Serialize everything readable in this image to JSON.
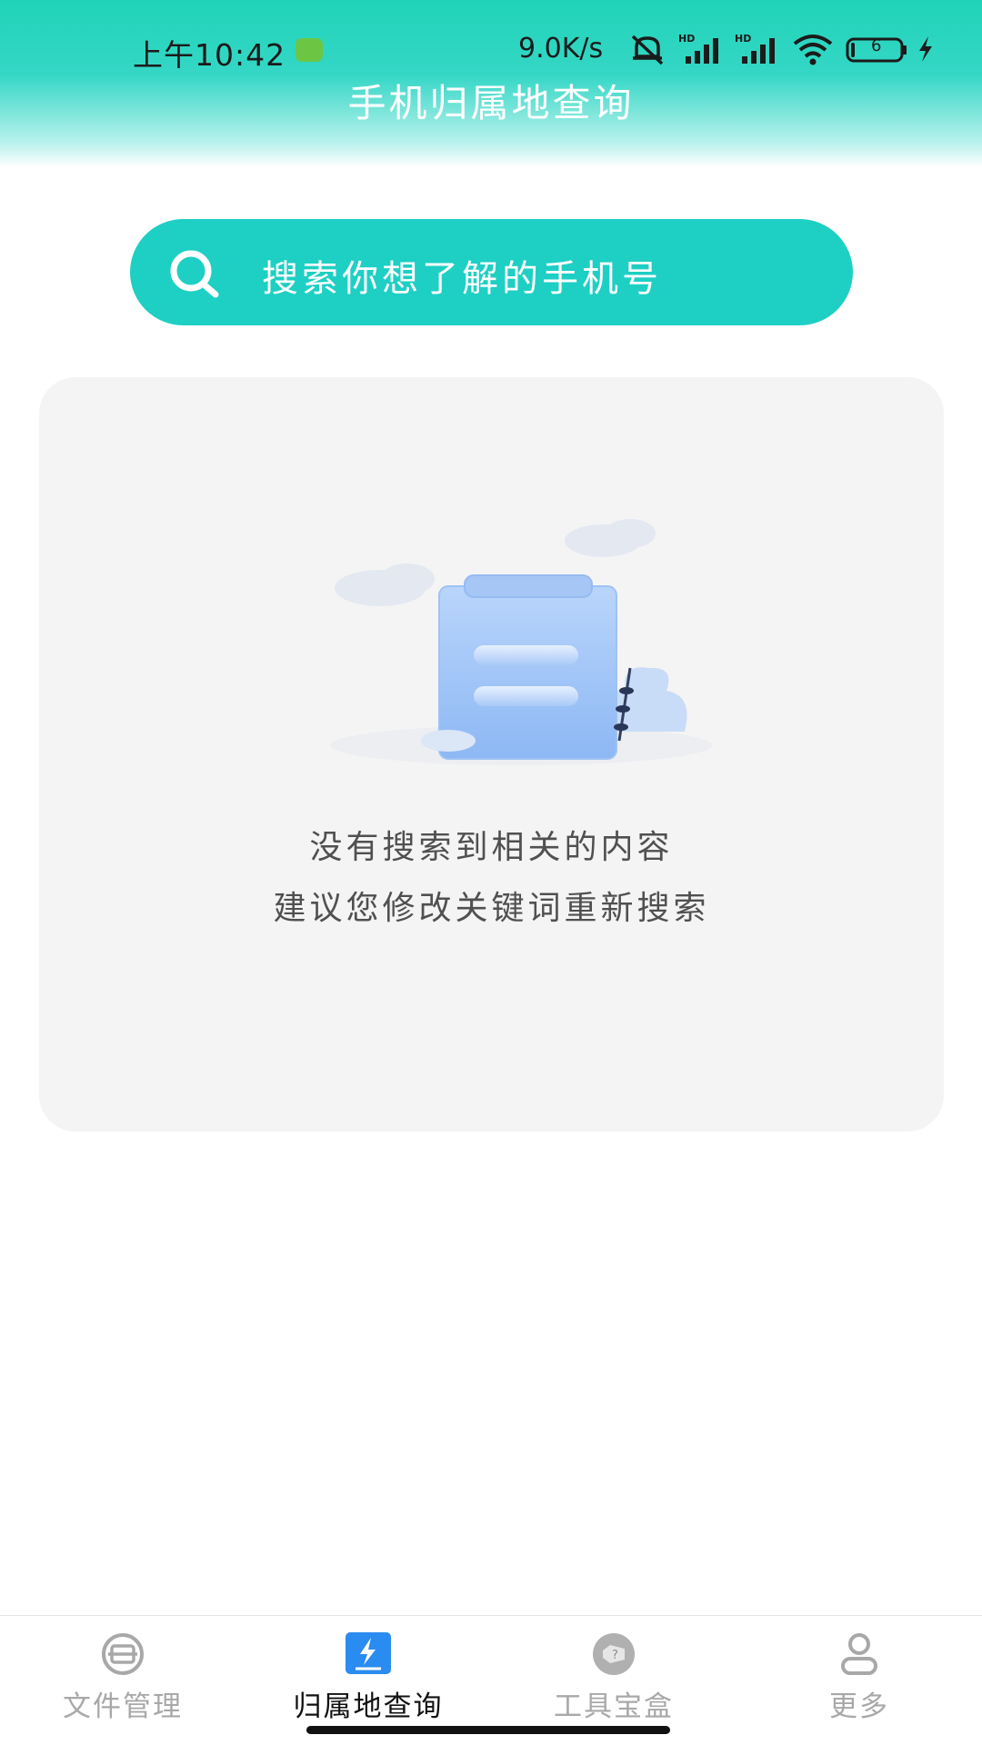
{
  "status_bar": {
    "time": "上午10:42",
    "net_speed": "9.0K/s",
    "battery_level": "6"
  },
  "header": {
    "title": "手机归属地查询"
  },
  "search": {
    "placeholder": "搜索你想了解的手机号"
  },
  "empty_state": {
    "line1": "没有搜索到相关的内容",
    "line2": "建议您修改关键词重新搜索"
  },
  "bottom_nav": {
    "items": [
      {
        "label": "文件管理",
        "icon": "file-scan-icon",
        "active": false
      },
      {
        "label": "归属地查询",
        "icon": "lightning-icon",
        "active": true
      },
      {
        "label": "工具宝盒",
        "icon": "toolbox-icon",
        "active": false
      },
      {
        "label": "更多",
        "icon": "user-icon",
        "active": false
      }
    ]
  },
  "colors": {
    "accent": "#1ecfc4",
    "active_nav_icon": "#2a8cf0",
    "inactive_nav": "#a8a8a8"
  }
}
